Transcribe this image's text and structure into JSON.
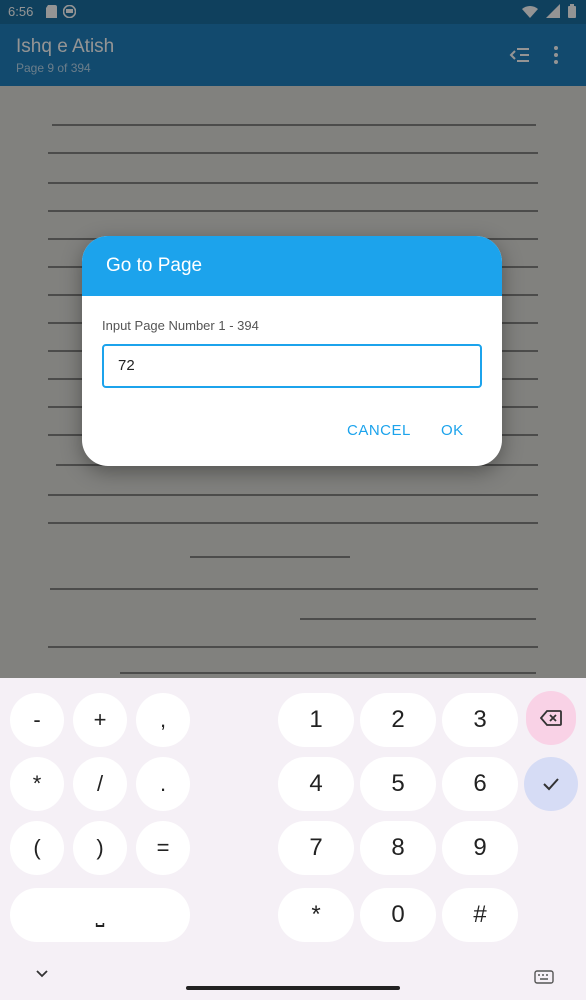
{
  "status_bar": {
    "time": "6:56"
  },
  "app_bar": {
    "title": "Ishq e Atish",
    "subtitle": "Page 9 of 394"
  },
  "dialog": {
    "title": "Go to Page",
    "label": "Input Page Number 1 - 394",
    "input_value": "72",
    "cancel_label": "CANCEL",
    "ok_label": "OK"
  },
  "keyboard": {
    "left_keys": [
      "-",
      "+",
      ",",
      "*",
      "/",
      ".",
      "(",
      ")",
      "="
    ],
    "num_keys": [
      "1",
      "2",
      "3",
      "4",
      "5",
      "6",
      "7",
      "8",
      "9",
      "*",
      "0",
      "#"
    ],
    "space_symbol": "⎵"
  },
  "colors": {
    "app_bar": "#1f80bd",
    "status_bar": "#1b6fa0",
    "dialog_accent": "#1ca3ec",
    "delete_key": "#f9d2e6",
    "ok_key": "#d6dcf5"
  }
}
